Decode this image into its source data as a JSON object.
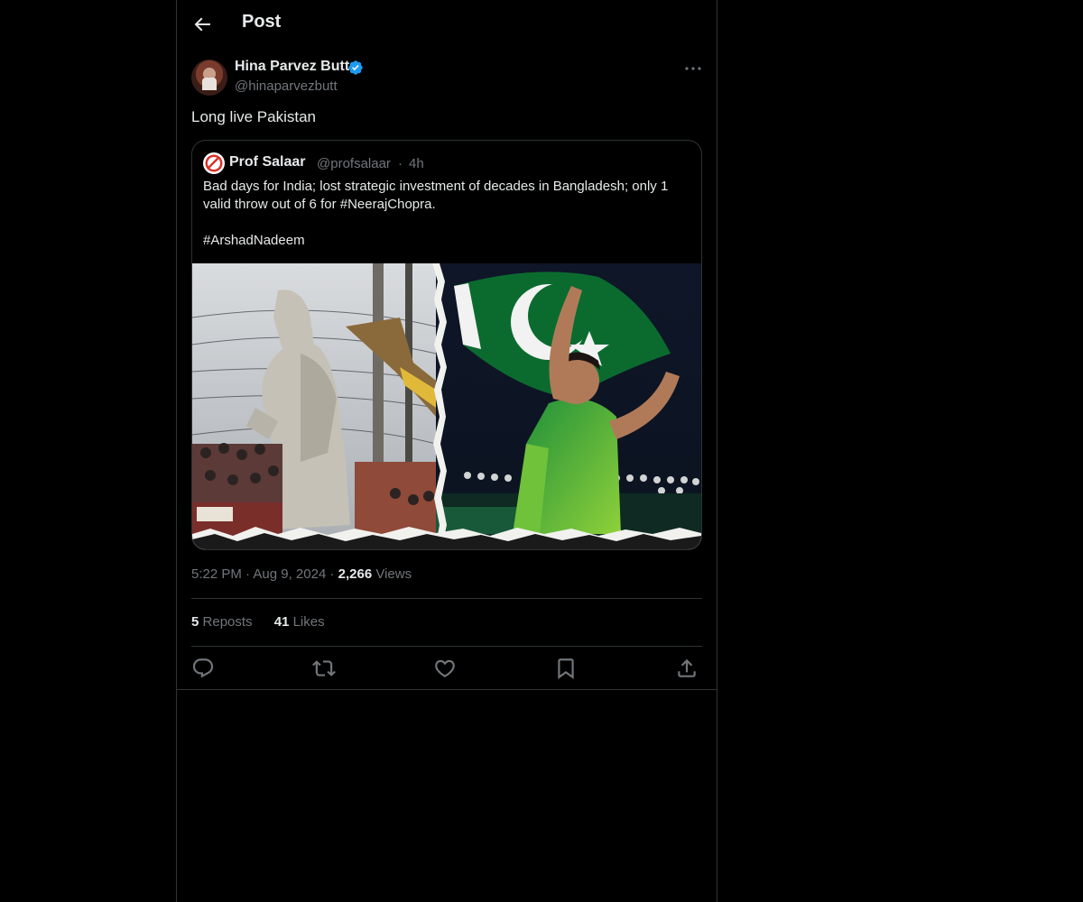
{
  "header": {
    "title": "Post",
    "back_icon": "arrow-left-icon"
  },
  "post": {
    "author_name": "Hina Parvez Butt",
    "author_handle": "@hinaparvezbutt",
    "verified": true,
    "text": "Long live Pakistan",
    "timestamp": "5:22 PM",
    "date": "Aug 9, 2024",
    "views_count": "2,266",
    "views_label": "Views",
    "reposts_count": "5",
    "reposts_label": "Reposts",
    "likes_count": "41",
    "likes_label": "Likes"
  },
  "quote": {
    "author_name": "Prof Salaar",
    "author_handle": "@profsalaar",
    "time": "4h",
    "text_line1": "Bad days for India; lost strategic investment of decades in Bangladesh; only 1 valid throw out of 6 for #NeerajChopra.",
    "text_line2": "#ArshadNadeem"
  },
  "actions": [
    {
      "name": "reply",
      "icon": "reply-icon"
    },
    {
      "name": "repost",
      "icon": "repost-icon"
    },
    {
      "name": "like",
      "icon": "heart-icon"
    },
    {
      "name": "bookmark",
      "icon": "bookmark-icon"
    },
    {
      "name": "share",
      "icon": "share-icon"
    }
  ],
  "colors": {
    "background": "#000000",
    "text": "#e7e9ea",
    "muted": "#71767b",
    "border": "#2f3336",
    "verified": "#1d9bf0"
  }
}
